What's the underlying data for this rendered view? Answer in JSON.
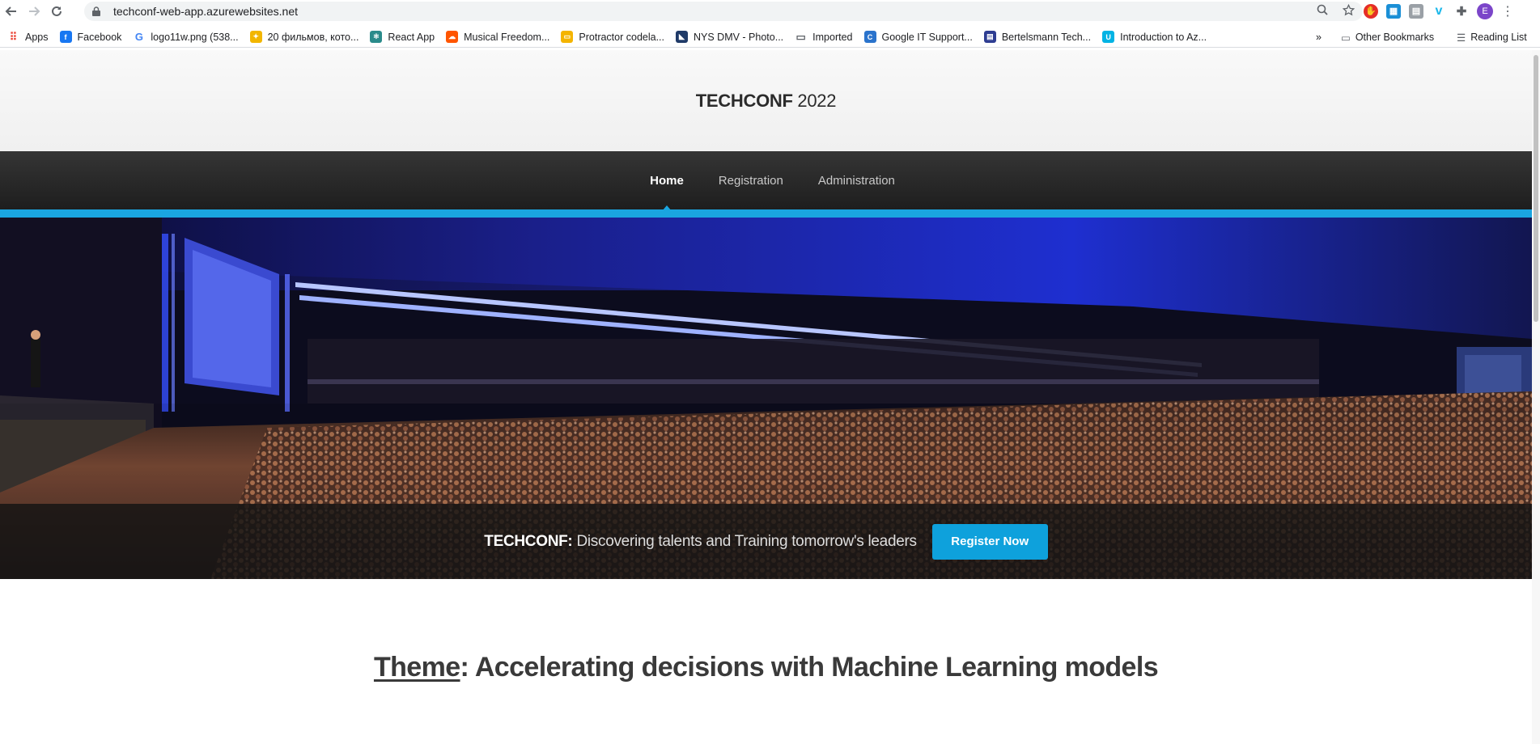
{
  "browser": {
    "url": "techconf-web-app.azurewebsites.net",
    "avatar_letter": "E",
    "bookmarks": [
      {
        "label": "Apps",
        "icon": "apps-grid-icon",
        "color": "#ea4335"
      },
      {
        "label": "Facebook",
        "icon": "facebook-icon",
        "color": "#1877f2"
      },
      {
        "label": "logo11w.png (538...",
        "icon": "google-icon",
        "color": "#4285f4"
      },
      {
        "label": "20 фильмов, кото...",
        "icon": "bulb-icon",
        "color": "#f2b600"
      },
      {
        "label": "React App",
        "icon": "react-icon",
        "color": "#2a8b8b"
      },
      {
        "label": "Musical Freedom...",
        "icon": "soundcloud-icon",
        "color": "#ff5500"
      },
      {
        "label": "Protractor codela...",
        "icon": "slides-icon",
        "color": "#f4b400"
      },
      {
        "label": "NYS DMV - Photo...",
        "icon": "nys-icon",
        "color": "#1f3a68"
      },
      {
        "label": "Imported",
        "icon": "folder-icon",
        "color": "#5f6368"
      },
      {
        "label": "Google IT Support...",
        "icon": "coursera-icon",
        "color": "#2a73cc"
      },
      {
        "label": "Bertelsmann Tech...",
        "icon": "udacity-icon",
        "color": "#2e3d92"
      },
      {
        "label": "Introduction to Az...",
        "icon": "udacity-u-icon",
        "color": "#02b3e4"
      }
    ],
    "overflow_label": "»",
    "other_bookmarks": "Other Bookmarks",
    "reading_list": "Reading List"
  },
  "site": {
    "brand_bold": "TECHCONF",
    "brand_year": " 2022",
    "nav": [
      {
        "label": "Home",
        "active": true
      },
      {
        "label": "Registration",
        "active": false
      },
      {
        "label": "Administration",
        "active": false
      }
    ],
    "tagline_bold": "TECHCONF:",
    "tagline_rest": " Discovering talents and Training tomorrow's leaders",
    "register_button": "Register Now",
    "theme_label": "Theme",
    "theme_text": ": Accelerating decisions with Machine Learning models",
    "accent_color": "#1aa5e0"
  }
}
